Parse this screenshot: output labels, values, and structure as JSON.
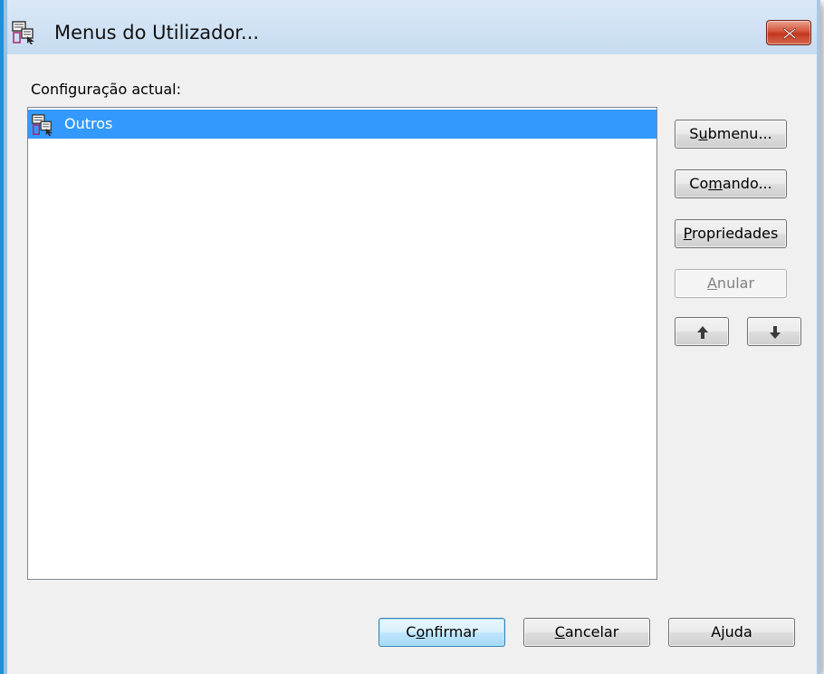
{
  "window": {
    "title": "Menus do Utilizador..."
  },
  "current_config": {
    "label": "Configuração actual:",
    "items": [
      {
        "label": "Outros",
        "selected": true,
        "icon": "menu-icon"
      }
    ]
  },
  "side_buttons": {
    "submenu": {
      "pre": "S",
      "key": "u",
      "post": "bmenu..."
    },
    "comando": {
      "pre": "Co",
      "key": "m",
      "post": "ando..."
    },
    "propriedades": {
      "pre": "",
      "key": "P",
      "post": "ropriedades"
    },
    "anular": {
      "pre": "",
      "key": "A",
      "post": "nular",
      "disabled": true
    },
    "move_up": {
      "icon": "arrow-up-icon"
    },
    "move_down": {
      "icon": "arrow-down-icon"
    }
  },
  "footer": {
    "confirmar": {
      "pre": "C",
      "key": "o",
      "post": "nfirmar"
    },
    "cancelar": {
      "pre": "",
      "key": "C",
      "post": "ancelar"
    },
    "ajuda": {
      "pre": "A",
      "key": "j",
      "post": "uda"
    }
  },
  "colors": {
    "selection": "#3399ff",
    "close_button": "#c9462b",
    "client_background": "#f0f0f0"
  }
}
